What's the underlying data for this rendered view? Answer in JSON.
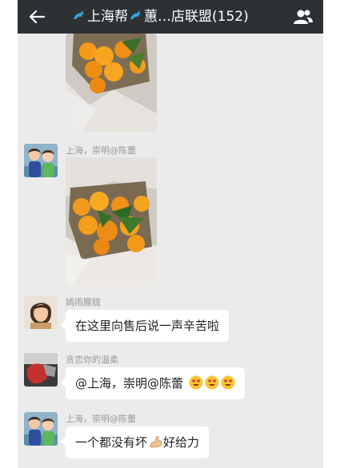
{
  "header": {
    "title_part1": "上海帮",
    "title_part2": "蕙…店联盟(152)",
    "back_icon": "arrow-left-icon",
    "members_icon": "group-members-icon",
    "background": "#2e3134"
  },
  "messages": [
    {
      "sender": "",
      "type": "image",
      "content": "oranges-photo"
    },
    {
      "sender": "上海，崇明@陈蕾",
      "type": "image",
      "content": "oranges-photo"
    },
    {
      "sender": "嫣雨朦胧",
      "type": "text",
      "text": "在这里向售后说一声辛苦啦"
    },
    {
      "sender": "贪恋你的温柔",
      "type": "text",
      "text": "@上海，崇明@陈蕾 ",
      "emoji": [
        "heart-eyes-emoji",
        "heart-eyes-emoji",
        "heart-eyes-emoji"
      ]
    },
    {
      "sender": "上海，崇明@陈蕾",
      "type": "text",
      "text_before": "一个都没有坏",
      "emoji": [
        "flexed-biceps-emoji"
      ],
      "text_after": "好给力"
    }
  ]
}
